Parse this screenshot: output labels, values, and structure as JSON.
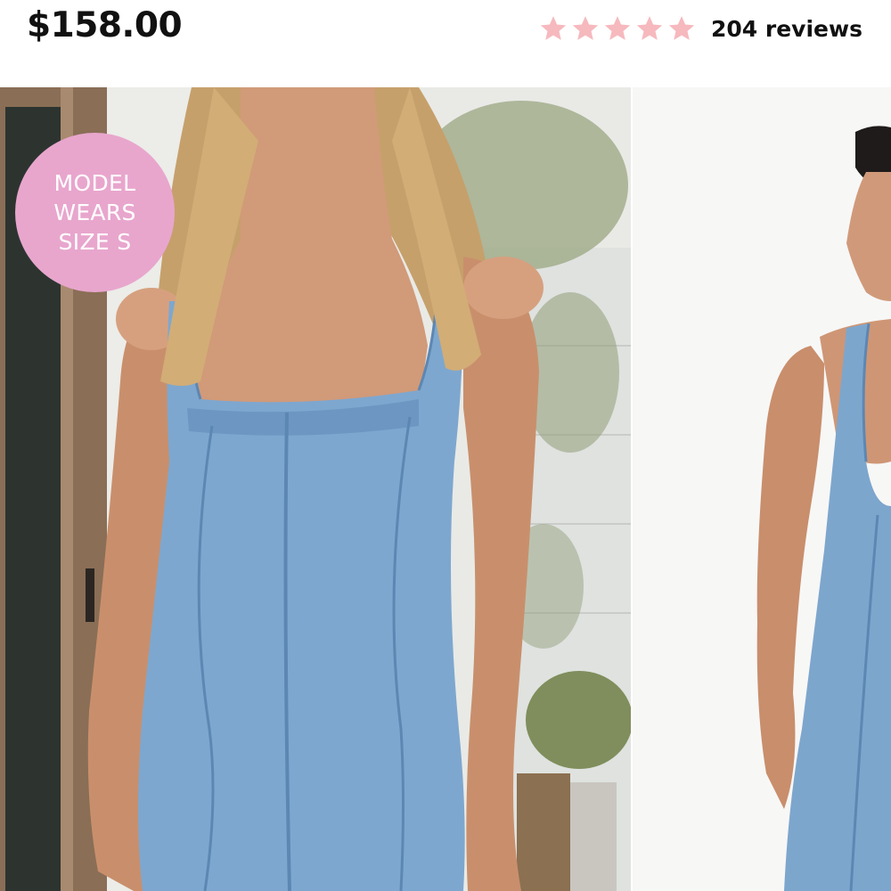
{
  "product": {
    "price": "$158.00",
    "rating": {
      "stars": 5,
      "reviews_label": "204 reviews",
      "star_color": "#f6b9bd"
    }
  },
  "badge": {
    "lines": [
      "MODEL",
      "WEARS",
      "SIZE S"
    ],
    "color": "#e8a6cd"
  },
  "gallery": {
    "images": [
      {
        "icon": "model-front-photo"
      },
      {
        "icon": "model-side-photo"
      }
    ]
  }
}
